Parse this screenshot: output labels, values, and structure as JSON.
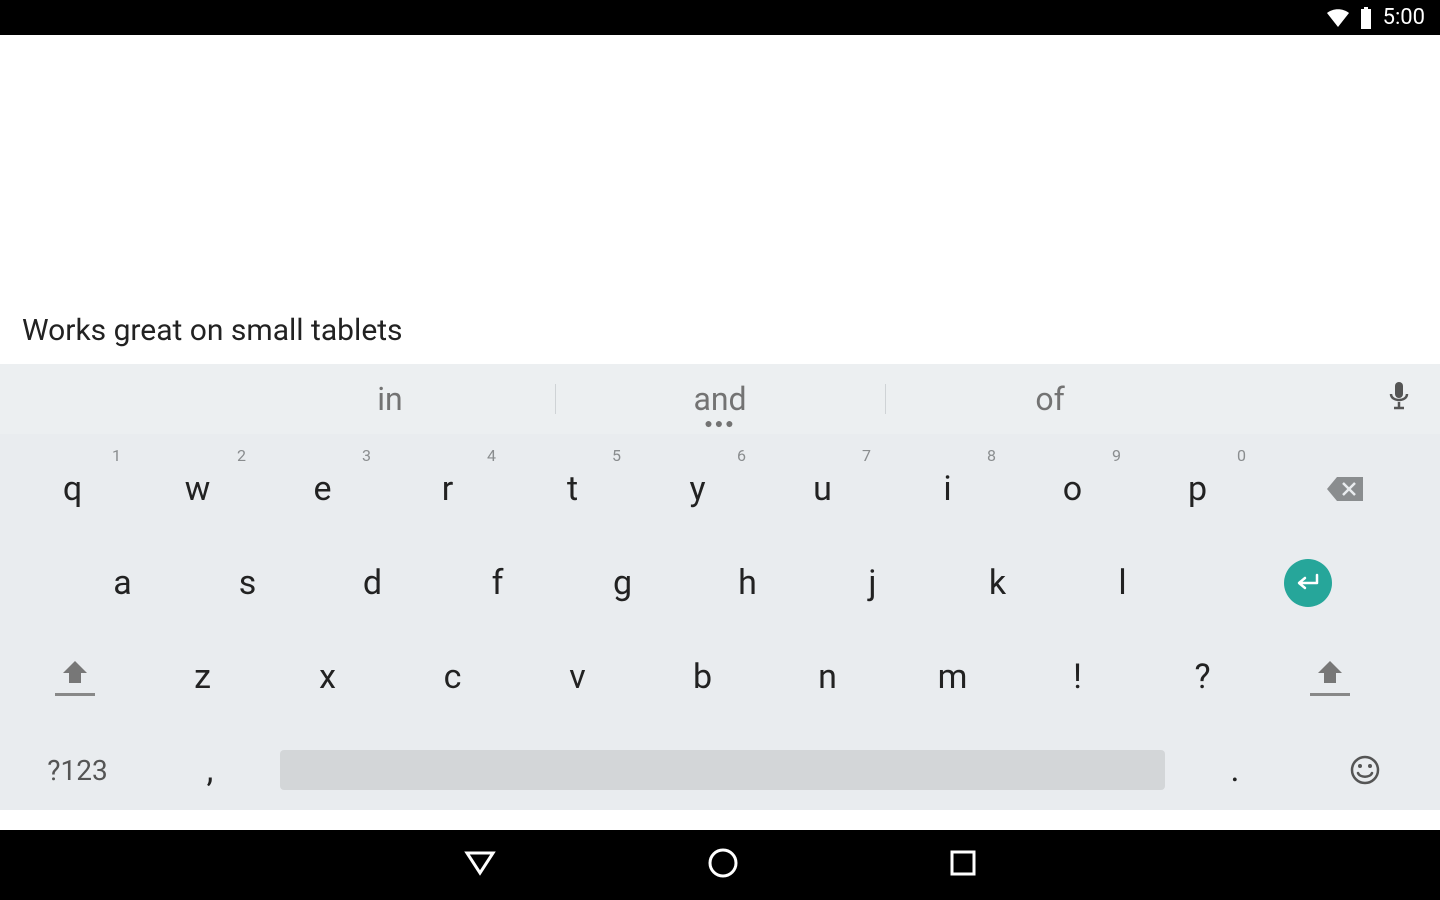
{
  "status": {
    "time": "5:00"
  },
  "input_text": "Works great on small tablets",
  "suggestions": [
    "in",
    "and",
    "of"
  ],
  "keys": {
    "row1": [
      {
        "label": "q",
        "hint": "1"
      },
      {
        "label": "w",
        "hint": "2"
      },
      {
        "label": "e",
        "hint": "3"
      },
      {
        "label": "r",
        "hint": "4"
      },
      {
        "label": "t",
        "hint": "5"
      },
      {
        "label": "y",
        "hint": "6"
      },
      {
        "label": "u",
        "hint": "7"
      },
      {
        "label": "i",
        "hint": "8"
      },
      {
        "label": "o",
        "hint": "9"
      },
      {
        "label": "p",
        "hint": "0"
      }
    ],
    "row2": [
      "a",
      "s",
      "d",
      "f",
      "g",
      "h",
      "j",
      "k",
      "l"
    ],
    "row3": [
      "z",
      "x",
      "c",
      "v",
      "b",
      "n",
      "m",
      "!",
      "?"
    ],
    "symbols": "?123",
    "comma": ",",
    "period": "."
  }
}
